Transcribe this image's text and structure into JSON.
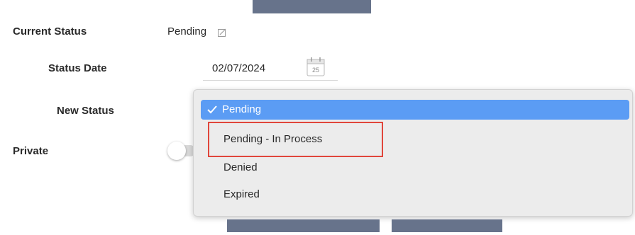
{
  "form": {
    "current_status_label": "Current Status",
    "current_status_value": "Pending",
    "status_date_label": "Status Date",
    "status_date_value": "02/07/2024",
    "calendar_day": "25",
    "new_status_label": "New Status",
    "private_label": "Private"
  },
  "dropdown": {
    "selected": "Pending",
    "options": [
      "Pending",
      "Pending - In Process",
      "Denied",
      "Expired"
    ],
    "highlighted_option": "Pending - In Process"
  },
  "colors": {
    "selected_bg": "#5b9cf4",
    "highlight_border": "#e0463b",
    "button_bar": "#67738b"
  },
  "icons": {
    "edit": "edit-icon",
    "calendar": "calendar-icon",
    "check": "checkmark-icon"
  }
}
